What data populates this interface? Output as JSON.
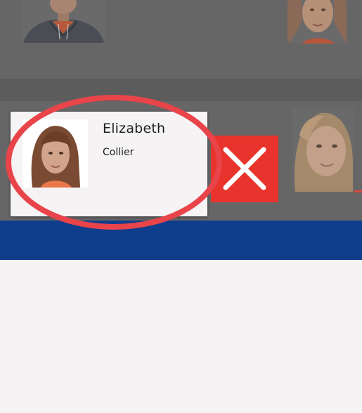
{
  "contacts": [
    {
      "photo_icon": "boy-avatar-photo"
    },
    {
      "photo_icon": "girl-avatar-photo"
    },
    {
      "first_name": "Elizabeth",
      "last_name": "Collier",
      "photo_icon": "girl-avatar-photo",
      "state": "dragged"
    },
    {
      "photo_icon": "blonde-girl-avatar-photo"
    }
  ],
  "swipe_action": {
    "icon": "close-icon",
    "color": "#e8342c"
  },
  "colors": {
    "overlay": "#666667",
    "card": "#f5f3f4",
    "bottom_bar": "#0e3d8c",
    "highlight": "#e8444a"
  },
  "annotation": {
    "icon": "highlight-ellipse"
  }
}
